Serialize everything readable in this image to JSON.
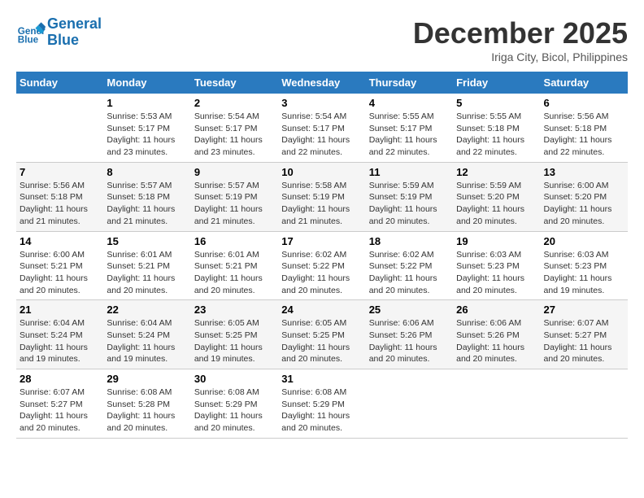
{
  "header": {
    "logo_line1": "General",
    "logo_line2": "Blue",
    "month": "December 2025",
    "location": "Iriga City, Bicol, Philippines"
  },
  "weekdays": [
    "Sunday",
    "Monday",
    "Tuesday",
    "Wednesday",
    "Thursday",
    "Friday",
    "Saturday"
  ],
  "weeks": [
    [
      {
        "day": "",
        "info": ""
      },
      {
        "day": "1",
        "info": "Sunrise: 5:53 AM\nSunset: 5:17 PM\nDaylight: 11 hours\nand 23 minutes."
      },
      {
        "day": "2",
        "info": "Sunrise: 5:54 AM\nSunset: 5:17 PM\nDaylight: 11 hours\nand 23 minutes."
      },
      {
        "day": "3",
        "info": "Sunrise: 5:54 AM\nSunset: 5:17 PM\nDaylight: 11 hours\nand 22 minutes."
      },
      {
        "day": "4",
        "info": "Sunrise: 5:55 AM\nSunset: 5:17 PM\nDaylight: 11 hours\nand 22 minutes."
      },
      {
        "day": "5",
        "info": "Sunrise: 5:55 AM\nSunset: 5:18 PM\nDaylight: 11 hours\nand 22 minutes."
      },
      {
        "day": "6",
        "info": "Sunrise: 5:56 AM\nSunset: 5:18 PM\nDaylight: 11 hours\nand 22 minutes."
      }
    ],
    [
      {
        "day": "7",
        "info": "Sunrise: 5:56 AM\nSunset: 5:18 PM\nDaylight: 11 hours\nand 21 minutes."
      },
      {
        "day": "8",
        "info": "Sunrise: 5:57 AM\nSunset: 5:18 PM\nDaylight: 11 hours\nand 21 minutes."
      },
      {
        "day": "9",
        "info": "Sunrise: 5:57 AM\nSunset: 5:19 PM\nDaylight: 11 hours\nand 21 minutes."
      },
      {
        "day": "10",
        "info": "Sunrise: 5:58 AM\nSunset: 5:19 PM\nDaylight: 11 hours\nand 21 minutes."
      },
      {
        "day": "11",
        "info": "Sunrise: 5:59 AM\nSunset: 5:19 PM\nDaylight: 11 hours\nand 20 minutes."
      },
      {
        "day": "12",
        "info": "Sunrise: 5:59 AM\nSunset: 5:20 PM\nDaylight: 11 hours\nand 20 minutes."
      },
      {
        "day": "13",
        "info": "Sunrise: 6:00 AM\nSunset: 5:20 PM\nDaylight: 11 hours\nand 20 minutes."
      }
    ],
    [
      {
        "day": "14",
        "info": "Sunrise: 6:00 AM\nSunset: 5:21 PM\nDaylight: 11 hours\nand 20 minutes."
      },
      {
        "day": "15",
        "info": "Sunrise: 6:01 AM\nSunset: 5:21 PM\nDaylight: 11 hours\nand 20 minutes."
      },
      {
        "day": "16",
        "info": "Sunrise: 6:01 AM\nSunset: 5:21 PM\nDaylight: 11 hours\nand 20 minutes."
      },
      {
        "day": "17",
        "info": "Sunrise: 6:02 AM\nSunset: 5:22 PM\nDaylight: 11 hours\nand 20 minutes."
      },
      {
        "day": "18",
        "info": "Sunrise: 6:02 AM\nSunset: 5:22 PM\nDaylight: 11 hours\nand 20 minutes."
      },
      {
        "day": "19",
        "info": "Sunrise: 6:03 AM\nSunset: 5:23 PM\nDaylight: 11 hours\nand 20 minutes."
      },
      {
        "day": "20",
        "info": "Sunrise: 6:03 AM\nSunset: 5:23 PM\nDaylight: 11 hours\nand 19 minutes."
      }
    ],
    [
      {
        "day": "21",
        "info": "Sunrise: 6:04 AM\nSunset: 5:24 PM\nDaylight: 11 hours\nand 19 minutes."
      },
      {
        "day": "22",
        "info": "Sunrise: 6:04 AM\nSunset: 5:24 PM\nDaylight: 11 hours\nand 19 minutes."
      },
      {
        "day": "23",
        "info": "Sunrise: 6:05 AM\nSunset: 5:25 PM\nDaylight: 11 hours\nand 19 minutes."
      },
      {
        "day": "24",
        "info": "Sunrise: 6:05 AM\nSunset: 5:25 PM\nDaylight: 11 hours\nand 20 minutes."
      },
      {
        "day": "25",
        "info": "Sunrise: 6:06 AM\nSunset: 5:26 PM\nDaylight: 11 hours\nand 20 minutes."
      },
      {
        "day": "26",
        "info": "Sunrise: 6:06 AM\nSunset: 5:26 PM\nDaylight: 11 hours\nand 20 minutes."
      },
      {
        "day": "27",
        "info": "Sunrise: 6:07 AM\nSunset: 5:27 PM\nDaylight: 11 hours\nand 20 minutes."
      }
    ],
    [
      {
        "day": "28",
        "info": "Sunrise: 6:07 AM\nSunset: 5:27 PM\nDaylight: 11 hours\nand 20 minutes."
      },
      {
        "day": "29",
        "info": "Sunrise: 6:08 AM\nSunset: 5:28 PM\nDaylight: 11 hours\nand 20 minutes."
      },
      {
        "day": "30",
        "info": "Sunrise: 6:08 AM\nSunset: 5:29 PM\nDaylight: 11 hours\nand 20 minutes."
      },
      {
        "day": "31",
        "info": "Sunrise: 6:08 AM\nSunset: 5:29 PM\nDaylight: 11 hours\nand 20 minutes."
      },
      {
        "day": "",
        "info": ""
      },
      {
        "day": "",
        "info": ""
      },
      {
        "day": "",
        "info": ""
      }
    ]
  ]
}
